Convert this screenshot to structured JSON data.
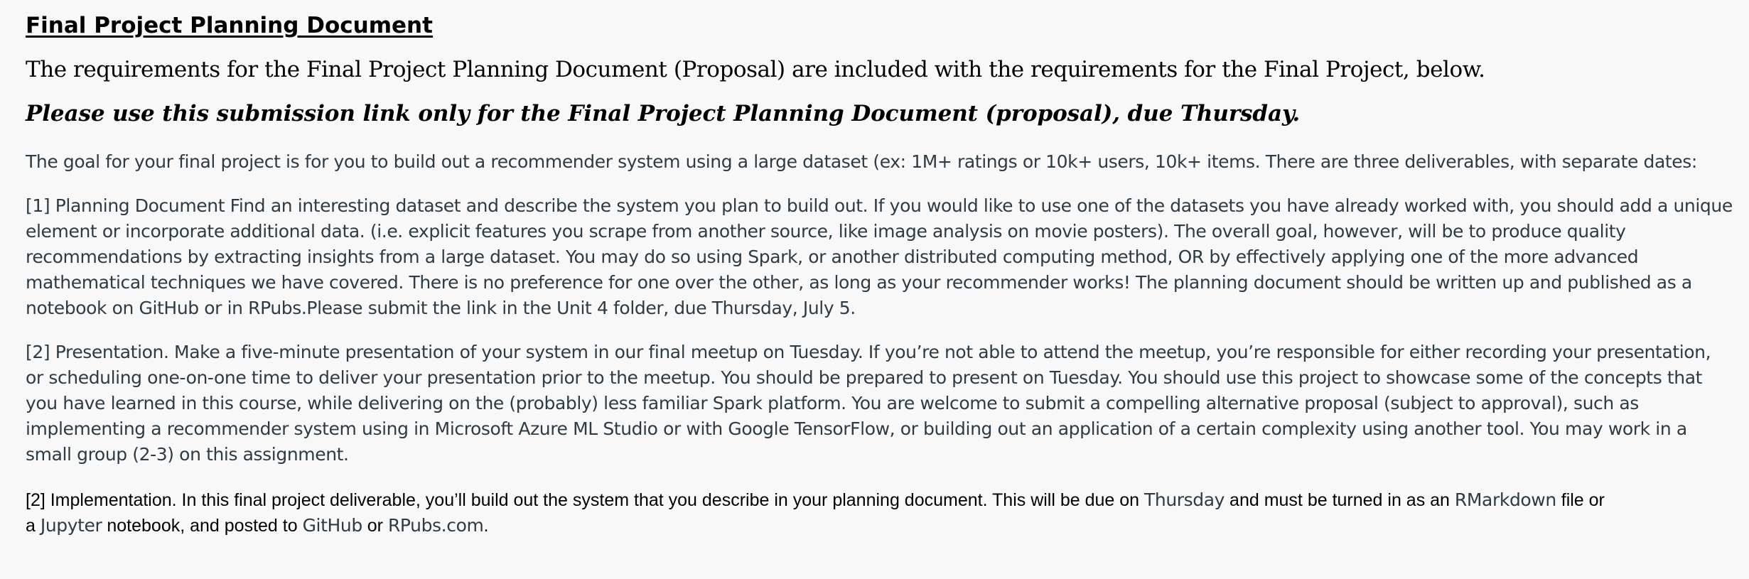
{
  "document": {
    "title": "Final Project Planning Document",
    "intro": "The requirements for the Final Project Planning Document (Proposal) are included with the requirements for the Final Project, below.",
    "notice": "Please use this submission link only for the Final Project Planning Document (proposal), due Thursday.",
    "goal": "The goal for your final project is for you to build out a recommender system using a large dataset (ex: 1M+ ratings or 10k+ users, 10k+ items. There are three deliverables, with separate dates:",
    "planning_lines": [
      "[1] Planning Document Find an interesting dataset and describe the system you plan to build out. If you would like to use one of the datasets you have already worked with, you should add a unique",
      "element or incorporate additional data. (i.e. explicit features you scrape from another source, like image analysis on movie posters). The overall goal, however, will be to produce quality",
      "recommendations by extracting insights from a large dataset. You may do so using Spark, or another distributed computing method, OR by effectively applying one of the more advanced",
      "mathematical techniques we have covered. There is no preference for one over the other, as long as your recommender works! The planning document should be written up and published as a",
      "notebook on GitHub or in RPubs.Please submit the link in the Unit 4 folder, due Thursday, July 5."
    ],
    "presentation_lines": [
      "[2] Presentation. Make a five-minute presentation of your system in our final meetup on Tuesday. If you’re not able to attend the meetup, you’re responsible for either recording your presentation,",
      "or scheduling one-on-one time to deliver your presentation prior to the meetup. You should be prepared to present on Tuesday. You should use this project to showcase some of the concepts that",
      "you have learned in this course, while delivering on the (probably) less familiar Spark platform. You are welcome to submit a compelling alternative proposal (subject to approval), such as",
      "implementing a recommender system using in Microsoft Azure ML Studio or with Google TensorFlow, or building out an application of a certain complexity using another tool. You may work in a",
      "small group (2-3) on this assignment."
    ],
    "implementation": {
      "line1_a": "[2] Implementation. In this final project deliverable, you’ll build out the system that you describe in your planning document. This will be due on ",
      "line1_b": "Thursday",
      "line1_c": " and must be turned in as an ",
      "line1_d": "RMarkdown",
      "line1_e": " file or",
      "line2_a": "a ",
      "line2_b": "Jupyter",
      "line2_c": " notebook, and posted to ",
      "line2_d": "GitHub",
      "line2_e": " or ",
      "line2_f": "RPubs.com",
      "line2_g": "."
    }
  }
}
